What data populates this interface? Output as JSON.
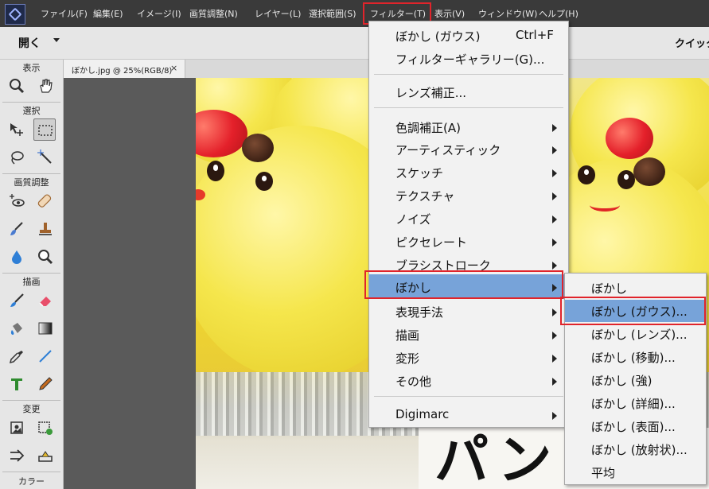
{
  "menubar": {
    "items": [
      "ファイル(F)",
      "編集(E)",
      "イメージ(I)",
      "画質調整(N)",
      "レイヤー(L)",
      "選択範囲(S)",
      "フィルター(T)",
      "表示(V)",
      "ウィンドウ(W)",
      "ヘルプ(H)"
    ],
    "active_item": "フィルター(T)"
  },
  "toolbar": {
    "open_label": "開く",
    "quick_label": "クイック"
  },
  "tools_panel": {
    "sections": [
      "表示",
      "選択",
      "画質調整",
      "描画",
      "変更",
      "カラー"
    ],
    "tools": [
      "zoom-icon",
      "hand-icon",
      "move-icon",
      "rectangular-marquee-icon",
      "lasso-icon",
      "magic-wand-icon",
      "red-eye-icon",
      "spot-healing-icon",
      "smart-brush-icon",
      "clone-stamp-icon",
      "blur-drop-icon",
      "sponge-icon",
      "brush-icon",
      "eraser-icon",
      "paint-bucket-icon",
      "gradient-icon",
      "eyedropper-icon",
      "line-icon",
      "type-icon",
      "pencil-icon",
      "crop-icon",
      "recompose-icon",
      "content-move-icon",
      "straighten-icon"
    ],
    "selected_tool": "rectangular-marquee-icon"
  },
  "document": {
    "tab_label": "ぼかし.jpg @ 25%(RGB/8)",
    "close_glyph": "×",
    "card_text": "パン"
  },
  "filter_menu": {
    "items": [
      {
        "label": "ぼかし (ガウス)",
        "shortcut": "Ctrl+F"
      },
      {
        "label": "フィルターギャラリー(G)..."
      },
      {
        "label": "レンズ補正..."
      },
      {
        "label": "色調補正(A)",
        "submenu": true
      },
      {
        "label": "アーティスティック",
        "submenu": true
      },
      {
        "label": "スケッチ",
        "submenu": true
      },
      {
        "label": "テクスチャ",
        "submenu": true
      },
      {
        "label": "ノイズ",
        "submenu": true
      },
      {
        "label": "ピクセレート",
        "submenu": true
      },
      {
        "label": "ブラシストローク",
        "submenu": true
      },
      {
        "label": "ぼかし",
        "submenu": true,
        "highlighted": true
      },
      {
        "label": "表現手法",
        "submenu": true
      },
      {
        "label": "描画",
        "submenu": true
      },
      {
        "label": "変形",
        "submenu": true
      },
      {
        "label": "その他",
        "submenu": true
      },
      {
        "label": "Digimarc",
        "submenu": true
      }
    ]
  },
  "blur_submenu": {
    "items": [
      {
        "label": "ぼかし"
      },
      {
        "label": "ぼかし (ガウス)...",
        "highlighted": true
      },
      {
        "label": "ぼかし (レンズ)..."
      },
      {
        "label": "ぼかし (移動)..."
      },
      {
        "label": "ぼかし (強)"
      },
      {
        "label": "ぼかし (詳細)..."
      },
      {
        "label": "ぼかし (表面)..."
      },
      {
        "label": "ぼかし (放射状)..."
      },
      {
        "label": "平均"
      }
    ]
  },
  "colors": {
    "menu_highlight": "#77a3d9",
    "callout_red": "#e0242b"
  }
}
